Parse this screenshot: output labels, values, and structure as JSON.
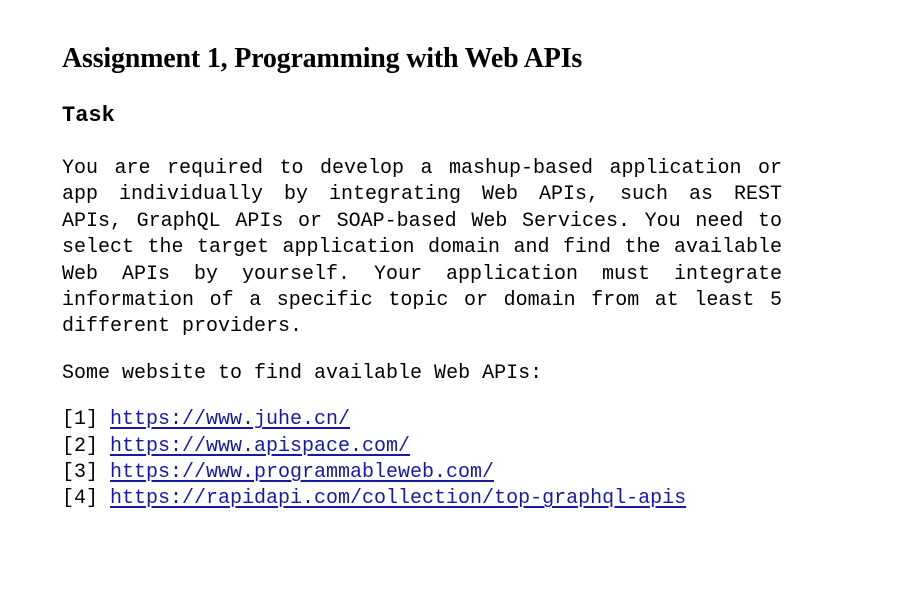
{
  "document": {
    "title": "Assignment 1, Programming with Web APIs",
    "section_heading": "Task",
    "paragraph": "You are required to develop a mashup-based application or app individually by integrating Web APIs, such as REST APIs, GraphQL APIs or SOAP-based Web Services. You need to select the target application domain and find the available Web APIs by yourself. Your application must integrate information of a specific topic or domain from at least 5 different providers.",
    "links_intro": "Some website to find available Web APIs:",
    "references": [
      {
        "number": "[1]",
        "url": "https://www.juhe.cn/"
      },
      {
        "number": "[2]",
        "url": "https://www.apispace.com/"
      },
      {
        "number": "[3]",
        "url": "https://www.programmableweb.com/"
      },
      {
        "number": "[4]",
        "url": "https://rapidapi.com/collection/top-graphql-apis"
      }
    ]
  },
  "colors": {
    "link": "#1a1a9c",
    "text": "#000000",
    "background": "#ffffff"
  }
}
